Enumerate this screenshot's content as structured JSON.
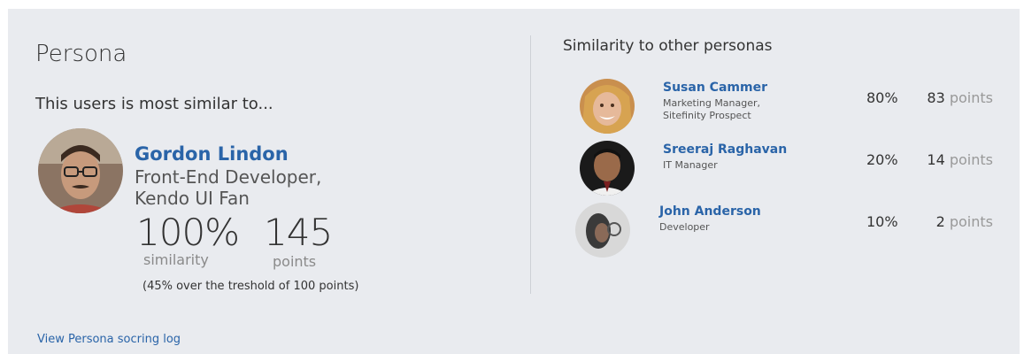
{
  "left": {
    "title": "Persona",
    "subtitle": "This users is most similar to...",
    "main": {
      "name": "Gordon Lindon",
      "role_line1": "Front-End Developer,",
      "role_line2": "Kendo UI Fan",
      "similarity_value": "100%",
      "similarity_label": "similarity",
      "points_value": "145",
      "points_label": "points",
      "threshold_note": "(45% over the treshold of 100 points)"
    },
    "log_link": "View Persona socring log"
  },
  "right": {
    "title": "Similarity to other personas",
    "personas": [
      {
        "name": "Susan Cammer",
        "role_line1": "Marketing Manager,",
        "role_line2": "Sitefinity Prospect",
        "similarity": "80%",
        "points": "83",
        "points_label": "points"
      },
      {
        "name": "Sreeraj Raghavan",
        "role_line1": "IT Manager",
        "role_line2": "",
        "similarity": "20%",
        "points": "14",
        "points_label": "points"
      },
      {
        "name": "John Anderson",
        "role_line1": "Developer",
        "role_line2": "",
        "similarity": "10%",
        "points": "2",
        "points_label": "points"
      }
    ]
  },
  "colors": {
    "panel_bg": "#e9ebef",
    "link_blue": "#2a64a8",
    "text_dark": "#333333",
    "text_muted": "#8a8a8a"
  }
}
